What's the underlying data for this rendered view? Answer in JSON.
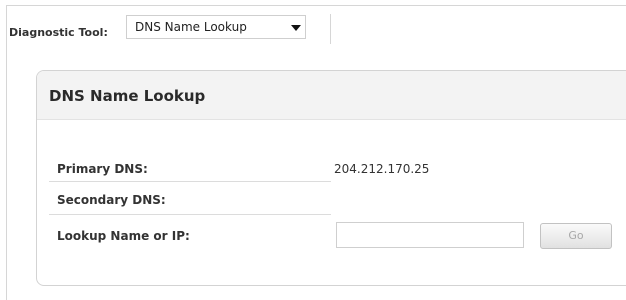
{
  "toolbar": {
    "label": "Diagnostic Tool:",
    "selected_tool": "DNS Name Lookup"
  },
  "panel": {
    "title": "DNS Name Lookup",
    "fields": [
      {
        "label": "Primary DNS:",
        "value": "204.212.170.25"
      },
      {
        "label": "Secondary DNS:",
        "value": ""
      },
      {
        "label": "Lookup Name or IP:",
        "value": ""
      }
    ],
    "go_label": "Go"
  },
  "icons": {
    "dropdown": "chevron-down-icon"
  },
  "colors": {
    "panel_header_bg": "#f3f3f3",
    "border": "#d3d3d3"
  }
}
